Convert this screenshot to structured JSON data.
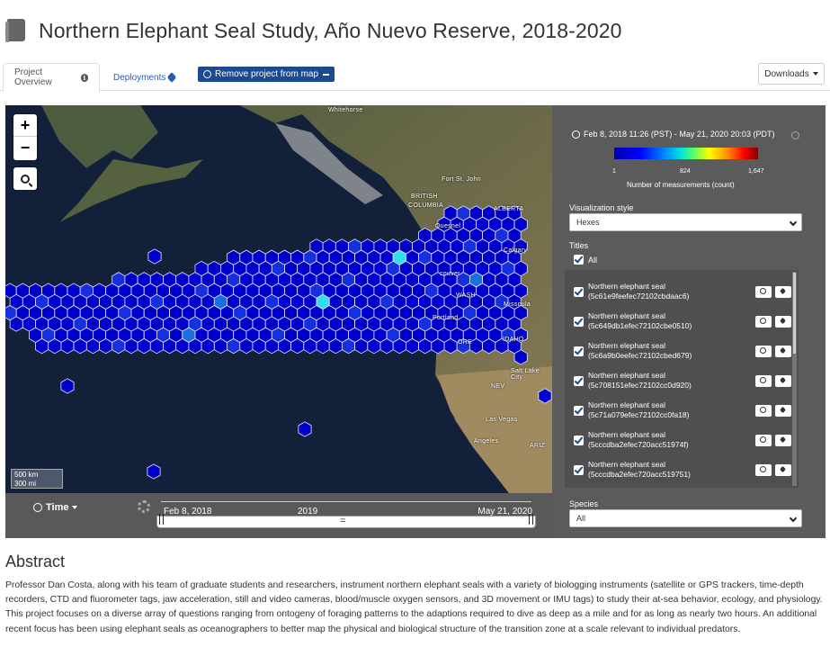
{
  "header": {
    "title": "Northern Elephant Seal Study, Año Nuevo Reserve, 2018-2020"
  },
  "tabs": {
    "overview": "Project Overview",
    "overview_icon": "info-icon",
    "deployments": "Deployments",
    "deployments_icon": "tag-icon",
    "remove": "Remove project from map",
    "downloads": "Downloads"
  },
  "map": {
    "zoom_in": "+",
    "zoom_out": "−",
    "scale_km": "500 km",
    "scale_mi": "300 mi",
    "labels": {
      "whitehorse": "Whitehorse",
      "fort_st_john": "Fort St. John",
      "bc_1": "BRITISH",
      "bc_2": "COLUMBIA",
      "alberta": "ALBERTA",
      "quesnel": "Quesnel",
      "calgary": "Calgary",
      "vancouver": "couver",
      "wash": "WASH",
      "missoula": "Missoula",
      "portland": "Portland",
      "ore": "ORE",
      "idaho": "IDAHO",
      "salt_lake": "Salt Lake City",
      "nev": "NEV",
      "las_vegas": "Las Vegas",
      "los_angeles": "Angeles",
      "ariz": "ARIZ"
    },
    "colors": {
      "low": "#0000cc",
      "mid": "#1a6fe0",
      "high_cyan": "#33ddee",
      "max": "#aa0000"
    }
  },
  "timeline": {
    "label": "Time",
    "start": "Feb 8, 2018",
    "mid": "2019",
    "end": "May 21, 2020",
    "grip": "="
  },
  "panel": {
    "date_range": "Feb 8, 2018 11:26 (PST) - May 21, 2020 20:03 (PDT)",
    "legend_min": "1",
    "legend_mid": "824",
    "legend_max": "1,647",
    "legend_title": "Number of measurements (count)",
    "viz_label": "Visualization style",
    "viz_value": "Hexes",
    "titles_label": "Titles",
    "all_label": "All",
    "items": [
      {
        "name": "Northern elephant seal",
        "id": "(5c61e9feefec72102cbdaac6)"
      },
      {
        "name": "Northern elephant seal",
        "id": "(5c649db1efec72102cbe0510)"
      },
      {
        "name": "Northern elephant seal",
        "id": "(5c6a9b0eefec72102cbed679)"
      },
      {
        "name": "Northern elephant seal",
        "id": "(5c708151efec72102cc0d920)"
      },
      {
        "name": "Northern elephant seal",
        "id": "(5c71a079efec72102cc0fa18)"
      },
      {
        "name": "Northern elephant seal",
        "id": "(5cccdba2efec720acc51974f)"
      },
      {
        "name": "Northern elephant seal",
        "id": "(5cccdba2efec720acc519751)"
      }
    ],
    "species_label": "Species",
    "species_value": "All"
  },
  "abstract": {
    "title": "Abstract",
    "text": "Professor Dan Costa, along with his team of graduate students and researchers, instrument northern elephant seals with a variety of biologging instruments (satellite or GPS trackers, time-depth recorders, CTD and fluorometer tags, jaw acceleration, still and video cameras, blood/muscle oxygen sensors, and 3D movement or IMU tags) to study their at-sea behavior, ecology, and physiology. This project focuses on a diverse array of questions ranging from ontogeny of foraging patterns to the adaptions required to dive as deep as a mile and for as long as nearly two hours. An additional recent focus has been using elephant seals as oceanographers to better map the physical and biological structure of the transition zone at a scale relevant to individual predators."
  }
}
